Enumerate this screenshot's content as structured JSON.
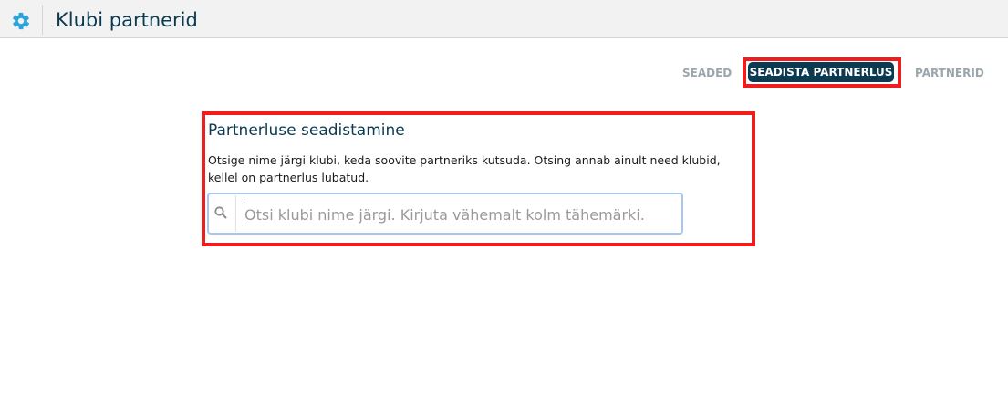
{
  "header": {
    "title": "Klubi partnerid",
    "icon": "gear-icon"
  },
  "tabs": {
    "settings": "SEADED",
    "setup": "SEADISTA PARTNERLUS",
    "partners": "PARTNERID",
    "active": "setup"
  },
  "panel": {
    "title": "Partnerluse seadistamine",
    "description": "Otsige nime järgi klubi, keda soovite partneriks kutsuda. Otsing annab ainult need klubid, kellel on partnerlus lubatud.",
    "search": {
      "value": "",
      "placeholder": "Otsi klubi nime järgi. Kirjuta vähemalt kolm tähemärki.",
      "icon": "search-icon"
    }
  },
  "colors": {
    "brand": "#0c3b51",
    "accent": "#2aa4d9",
    "highlight": "#ef1e1e",
    "focus": "#a8c7f0"
  }
}
